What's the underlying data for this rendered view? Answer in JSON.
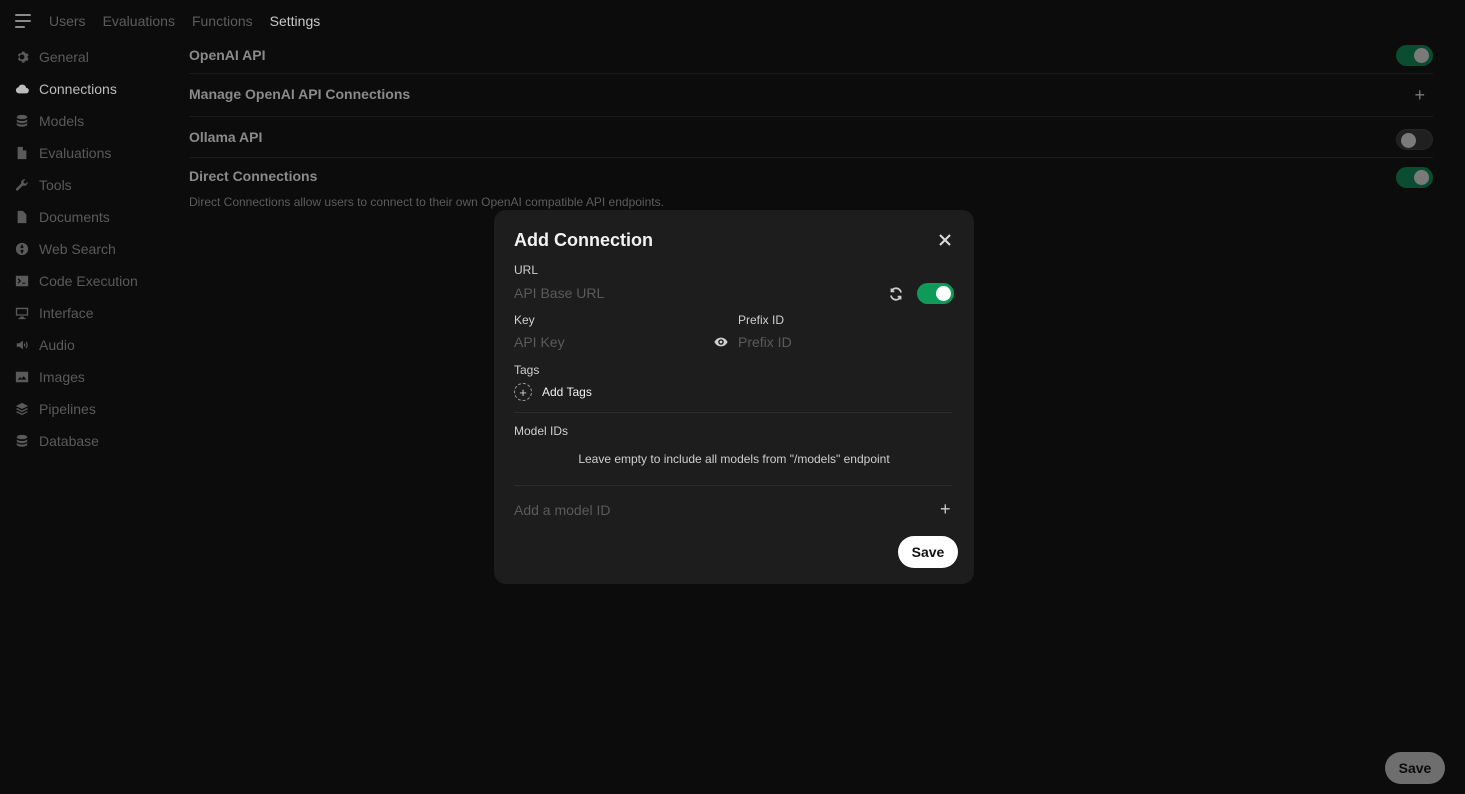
{
  "topnav": {
    "tabs": [
      {
        "label": "Users"
      },
      {
        "label": "Evaluations"
      },
      {
        "label": "Functions"
      },
      {
        "label": "Settings"
      }
    ]
  },
  "sidebar": {
    "items": [
      {
        "label": "General",
        "icon": "gear-icon"
      },
      {
        "label": "Connections",
        "icon": "cloud-icon"
      },
      {
        "label": "Models",
        "icon": "stack-icon"
      },
      {
        "label": "Evaluations",
        "icon": "document-icon"
      },
      {
        "label": "Tools",
        "icon": "wrench-icon"
      },
      {
        "label": "Documents",
        "icon": "document-icon"
      },
      {
        "label": "Web Search",
        "icon": "globe-icon"
      },
      {
        "label": "Code Execution",
        "icon": "terminal-icon"
      },
      {
        "label": "Interface",
        "icon": "monitor-icon"
      },
      {
        "label": "Audio",
        "icon": "speaker-icon"
      },
      {
        "label": "Images",
        "icon": "image-icon"
      },
      {
        "label": "Pipelines",
        "icon": "layers-icon"
      },
      {
        "label": "Database",
        "icon": "database-icon"
      }
    ],
    "active": "Connections"
  },
  "settings": {
    "openai_api_label": "OpenAI API",
    "openai_api_enabled": true,
    "manage_openai_label": "Manage OpenAI API Connections",
    "ollama_api_label": "Ollama API",
    "ollama_api_enabled": false,
    "direct_connections_label": "Direct Connections",
    "direct_connections_enabled": true,
    "direct_connections_desc": "Direct Connections allow users to connect to their own OpenAI compatible API endpoints.",
    "save_label": "Save"
  },
  "modal": {
    "title": "Add Connection",
    "url_label": "URL",
    "url_placeholder": "API Base URL",
    "url_value": "",
    "enabled": true,
    "key_label": "Key",
    "key_placeholder": "API Key",
    "key_value": "",
    "prefix_label": "Prefix ID",
    "prefix_placeholder": "Prefix ID",
    "prefix_value": "",
    "tags_label": "Tags",
    "add_tags_label": "Add Tags",
    "model_ids_label": "Model IDs",
    "model_ids_hint": "Leave empty to include all models from \"/models\" endpoint",
    "add_model_placeholder": "Add a model ID",
    "save_label": "Save"
  }
}
